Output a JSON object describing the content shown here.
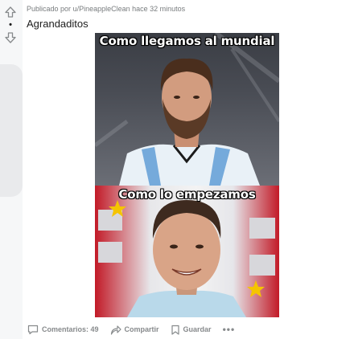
{
  "post": {
    "meta_prefix": "Publicado por",
    "author": "u/PineappleClean",
    "time": "hace 32 minutos",
    "title": "Agrandaditos",
    "vote_count": "•"
  },
  "meme": {
    "top_caption": "Como llegamos al mundial",
    "bottom_caption": "Como lo empezamos"
  },
  "actions": {
    "comments_label": "Comentarios: 49",
    "share_label": "Compartir",
    "save_label": "Guardar",
    "more_label": "•••"
  },
  "icons": {
    "upvote": "arrow-up-icon",
    "downvote": "arrow-down-icon",
    "comment": "comment-icon",
    "share": "share-icon",
    "save": "bookmark-icon",
    "more": "more-icon"
  },
  "colors": {
    "meta_text": "#787c7e",
    "action_text": "#878a8c",
    "sidebar_bg": "#f6f7f8"
  }
}
